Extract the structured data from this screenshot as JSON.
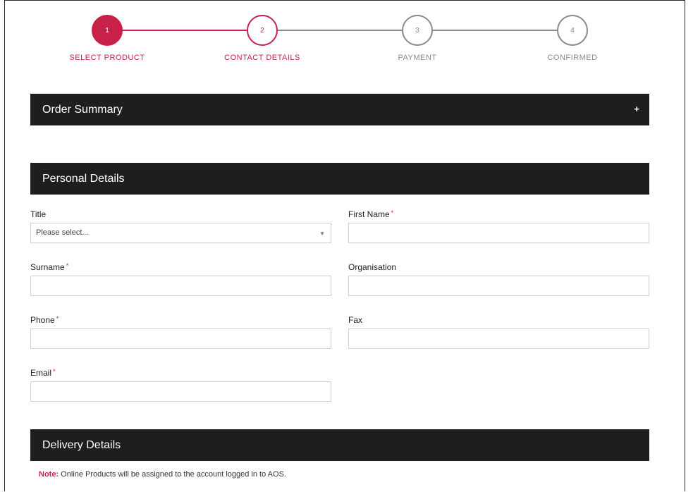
{
  "colors": {
    "accent": "#c9204a",
    "inactive": "#8a8a8a",
    "header_bg": "#1f1e1f"
  },
  "stepper": {
    "steps": [
      {
        "number": "1",
        "label": "SELECT PRODUCT",
        "state": "done"
      },
      {
        "number": "2",
        "label": "CONTACT DETAILS",
        "state": "current"
      },
      {
        "number": "3",
        "label": "PAYMENT",
        "state": "upcoming"
      },
      {
        "number": "4",
        "label": "CONFIRMED",
        "state": "upcoming"
      }
    ]
  },
  "order_summary": {
    "title": "Order Summary",
    "toggle": "+"
  },
  "personal_details": {
    "title": "Personal Details",
    "fields": {
      "title": {
        "label": "Title",
        "value": "Please select..."
      },
      "first_name": {
        "label": "First Name",
        "required": "*",
        "value": ""
      },
      "surname": {
        "label": "Surname",
        "required": "*",
        "value": ""
      },
      "organisation": {
        "label": "Organisation",
        "value": ""
      },
      "phone": {
        "label": "Phone",
        "required": "*",
        "value": ""
      },
      "fax": {
        "label": "Fax",
        "value": ""
      },
      "email": {
        "label": "Email",
        "required": "*",
        "value": ""
      }
    }
  },
  "delivery_details": {
    "title": "Delivery Details",
    "note_label": "Note:",
    "note_text": " Online Products will be assigned to the account logged in to AOS."
  }
}
